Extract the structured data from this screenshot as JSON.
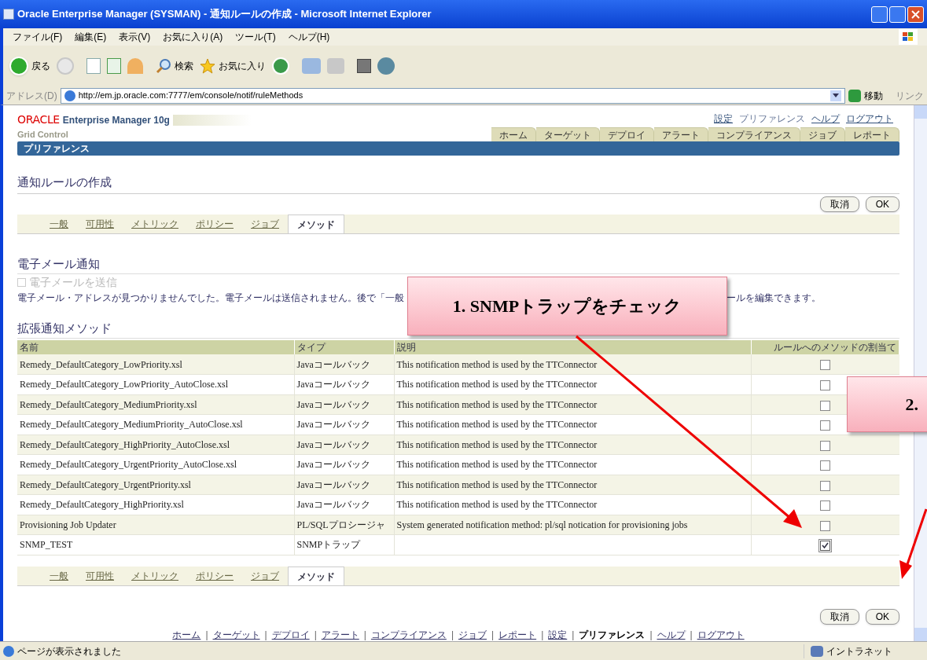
{
  "window": {
    "title": "Oracle Enterprise Manager (SYSMAN) - 通知ルールの作成 - Microsoft Internet Explorer"
  },
  "menu": [
    "ファイル(F)",
    "編集(E)",
    "表示(V)",
    "お気に入り(A)",
    "ツール(T)",
    "ヘルプ(H)"
  ],
  "toolbar": {
    "back": "戻る",
    "search": "検索",
    "favorites": "お気に入り"
  },
  "address_bar": {
    "label": "アドレス(D)",
    "url": "http://em.jp.oracle.com:7777/em/console/notif/ruleMethods",
    "go": "移動",
    "links": "リンク"
  },
  "header": {
    "brand": "ORACLE",
    "product": "Enterprise Manager 10g",
    "subtitle": "Grid Control",
    "global_links": [
      {
        "label": "設定",
        "selected": false
      },
      {
        "label": "プリファレンス",
        "selected": true
      },
      {
        "label": "ヘルプ",
        "selected": false
      },
      {
        "label": "ログアウト",
        "selected": false
      }
    ],
    "tabs": [
      {
        "label": "ホーム",
        "selected": false
      },
      {
        "label": "ターゲット",
        "selected": false
      },
      {
        "label": "デプロイ",
        "selected": false
      },
      {
        "label": "アラート",
        "selected": false
      },
      {
        "label": "コンプライアンス",
        "selected": false
      },
      {
        "label": "ジョブ",
        "selected": false
      },
      {
        "label": "レポート",
        "selected": false
      }
    ],
    "bar_title": "プリファレンス"
  },
  "page_title": "通知ルールの作成",
  "buttons": [
    "取消",
    "OK"
  ],
  "subtabs": [
    {
      "label": "一般",
      "selected": false
    },
    {
      "label": "可用性",
      "selected": false
    },
    {
      "label": "メトリック",
      "selected": false
    },
    {
      "label": "ポリシー",
      "selected": false
    },
    {
      "label": "ジョブ",
      "selected": false
    },
    {
      "label": "メソッド",
      "selected": true
    }
  ],
  "email": {
    "heading": "電子メール通知",
    "checkbox": {
      "label": "電子メールを送信",
      "checked": false,
      "disabled": true
    },
    "notice_start": "電子メール・アドレスが見つかりませんでした。電子メールは送信されません。後で「一般",
    "notice_end": "ールを編集できます。"
  },
  "methods": {
    "heading": "拡張通知メソッド",
    "columns": [
      "名前",
      "タイプ",
      "説明",
      "ルールへのメソッドの割当て"
    ],
    "rows": [
      {
        "name": "Remedy_DefaultCategory_LowPriority.xsl",
        "type": "Javaコールバック",
        "description": "This notification method is used by the TTConnector",
        "checked": false
      },
      {
        "name": "Remedy_DefaultCategory_LowPriority_AutoClose.xsl",
        "type": "Javaコールバック",
        "description": "This notification method is used by the TTConnector",
        "checked": false
      },
      {
        "name": "Remedy_DefaultCategory_MediumPriority.xsl",
        "type": "Javaコールバック",
        "description": "This notification method is used by the TTConnector",
        "checked": false
      },
      {
        "name": "Remedy_DefaultCategory_MediumPriority_AutoClose.xsl",
        "type": "Javaコールバック",
        "description": "This notification method is used by the TTConnector",
        "checked": false
      },
      {
        "name": "Remedy_DefaultCategory_HighPriority_AutoClose.xsl",
        "type": "Javaコールバック",
        "description": "This notification method is used by the TTConnector",
        "checked": false
      },
      {
        "name": "Remedy_DefaultCategory_UrgentPriority_AutoClose.xsl",
        "type": "Javaコールバック",
        "description": "This notification method is used by the TTConnector",
        "checked": false
      },
      {
        "name": "Remedy_DefaultCategory_UrgentPriority.xsl",
        "type": "Javaコールバック",
        "description": "This notification method is used by the TTConnector",
        "checked": false
      },
      {
        "name": "Remedy_DefaultCategory_HighPriority.xsl",
        "type": "Javaコールバック",
        "description": "This notification method is used by the TTConnector",
        "checked": false
      },
      {
        "name": "Provisioning Job Updater",
        "type": "PL/SQLプロシージャ",
        "description": "System generated notification method: pl/sql notication for provisioning jobs",
        "checked": false
      },
      {
        "name": "SNMP_TEST",
        "type": "SNMPトラップ",
        "description": "",
        "checked": true
      }
    ]
  },
  "bottom_subtabs": [
    {
      "label": "一般",
      "selected": false
    },
    {
      "label": "可用性",
      "selected": false
    },
    {
      "label": "メトリック",
      "selected": false
    },
    {
      "label": "ポリシー",
      "selected": false
    },
    {
      "label": "ジョブ",
      "selected": false
    },
    {
      "label": "メソッド",
      "selected": true
    }
  ],
  "bottom_buttons": [
    "取消",
    "OK"
  ],
  "footer_links": [
    {
      "kind": "link",
      "label": "ホーム",
      "selected": false
    },
    {
      "kind": "separator",
      "label": "|"
    },
    {
      "kind": "link",
      "label": "ターゲット",
      "selected": false
    },
    {
      "kind": "separator",
      "label": "|"
    },
    {
      "kind": "link",
      "label": "デプロイ",
      "selected": false
    },
    {
      "kind": "separator",
      "label": "|"
    },
    {
      "kind": "link",
      "label": "アラート",
      "selected": false
    },
    {
      "kind": "separator",
      "label": "|"
    },
    {
      "kind": "link",
      "label": "コンプライアンス",
      "selected": false
    },
    {
      "kind": "separator",
      "label": "|"
    },
    {
      "kind": "link",
      "label": "ジョブ",
      "selected": false
    },
    {
      "kind": "separator",
      "label": "|"
    },
    {
      "kind": "link",
      "label": "レポート",
      "selected": false
    },
    {
      "kind": "separator",
      "label": "|"
    },
    {
      "kind": "link",
      "label": "設定",
      "selected": false
    },
    {
      "kind": "separator",
      "label": "|"
    },
    {
      "kind": "link",
      "label": "プリファレンス",
      "selected": true
    },
    {
      "kind": "separator",
      "label": "|"
    },
    {
      "kind": "link",
      "label": "ヘルプ",
      "selected": false
    },
    {
      "kind": "separator",
      "label": "|"
    },
    {
      "kind": "link",
      "label": "ログアウト",
      "selected": false
    }
  ],
  "status_bar": {
    "text": "ページが表示されました",
    "zone": "イントラネット"
  },
  "annotations": [
    {
      "text": "1. SNMPトラップをチェック"
    },
    {
      "text": "2."
    }
  ]
}
